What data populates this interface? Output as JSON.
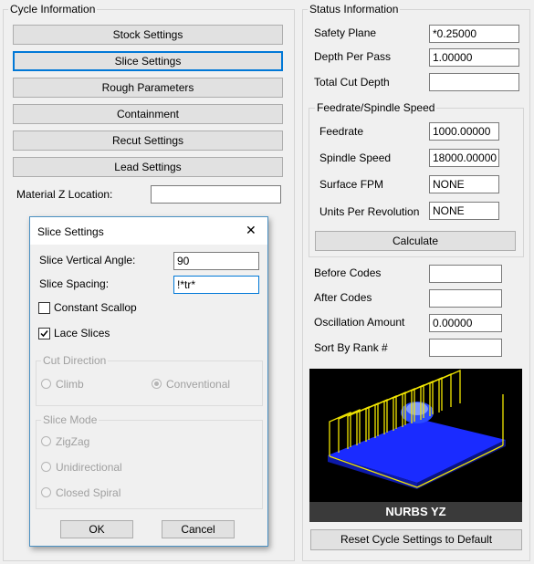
{
  "cycle_info": {
    "title": "Cycle Information",
    "buttons": [
      "Stock Settings",
      "Slice Settings",
      "Rough Parameters",
      "Containment",
      "Recut Settings",
      "Lead Settings"
    ],
    "material_z_label": "Material Z Location:",
    "material_z_value": ""
  },
  "status_info": {
    "title": "Status Information",
    "safety_plane_label": "Safety Plane",
    "safety_plane_value": "*0.25000",
    "depth_per_pass_label": "Depth Per Pass",
    "depth_per_pass_value": "1.00000",
    "total_cut_depth_label": "Total Cut Depth",
    "total_cut_depth_value": "",
    "feed_group_title": "Feedrate/Spindle Speed",
    "feedrate_label": "Feedrate",
    "feedrate_value": "1000.00000",
    "spindle_label": "Spindle Speed",
    "spindle_value": "18000.00000",
    "surface_fpm_label": "Surface FPM",
    "surface_fpm_value": "NONE",
    "upr_label": "Units Per Revolution",
    "upr_value": "NONE",
    "calculate_label": "Calculate",
    "before_codes_label": "Before Codes",
    "before_codes_value": "",
    "after_codes_label": "After Codes",
    "after_codes_value": "",
    "oscillation_label": "Oscillation Amount",
    "oscillation_value": "0.00000",
    "sort_rank_label": "Sort By Rank #",
    "sort_rank_value": "",
    "preview_caption": "NURBS YZ",
    "reset_label": "Reset Cycle Settings to Default"
  },
  "dialog": {
    "title": "Slice Settings",
    "close_glyph": "✕",
    "vertical_angle_label": "Slice Vertical Angle:",
    "vertical_angle_value": "90",
    "spacing_label": "Slice Spacing:",
    "spacing_value": "!*tr*",
    "constant_scallop_label": "Constant Scallop",
    "constant_scallop_checked": false,
    "lace_slices_label": "Lace Slices",
    "lace_slices_checked": true,
    "cut_direction_title": "Cut Direction",
    "climb_label": "Climb",
    "conventional_label": "Conventional",
    "slice_mode_title": "Slice Mode",
    "zigzag_label": "ZigZag",
    "unidirectional_label": "Unidirectional",
    "closed_spiral_label": "Closed Spiral",
    "ok_label": "OK",
    "cancel_label": "Cancel"
  },
  "colors": {
    "accent": "#0078d7",
    "preview_bg": "#000000",
    "preview_caption_bg": "#3a3a3a",
    "toolpath_blue": "#1a2bff",
    "toolpath_yellow": "#f2e600"
  }
}
